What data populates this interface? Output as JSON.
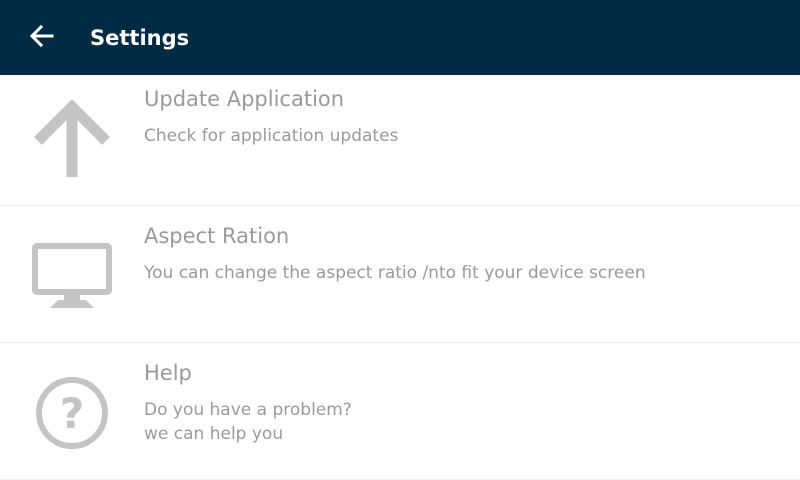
{
  "header": {
    "title": "Settings",
    "back_icon": "arrow-left-icon",
    "background_color": "#002b44"
  },
  "settings": {
    "items": [
      {
        "icon": "arrow-up-icon",
        "title": "Update Application",
        "subtitle": "Check for application updates"
      },
      {
        "icon": "monitor-icon",
        "title": "Aspect Ration",
        "subtitle": "You can change the aspect ratio /nto fit your device screen"
      },
      {
        "icon": "help-circle-icon",
        "title": "Help",
        "subtitle": "Do you have a problem?\nwe can help you"
      }
    ]
  },
  "colors": {
    "text_gray": "#9a9a9a",
    "icon_gray": "#c4c4c4",
    "divider": "#eeeeee"
  }
}
